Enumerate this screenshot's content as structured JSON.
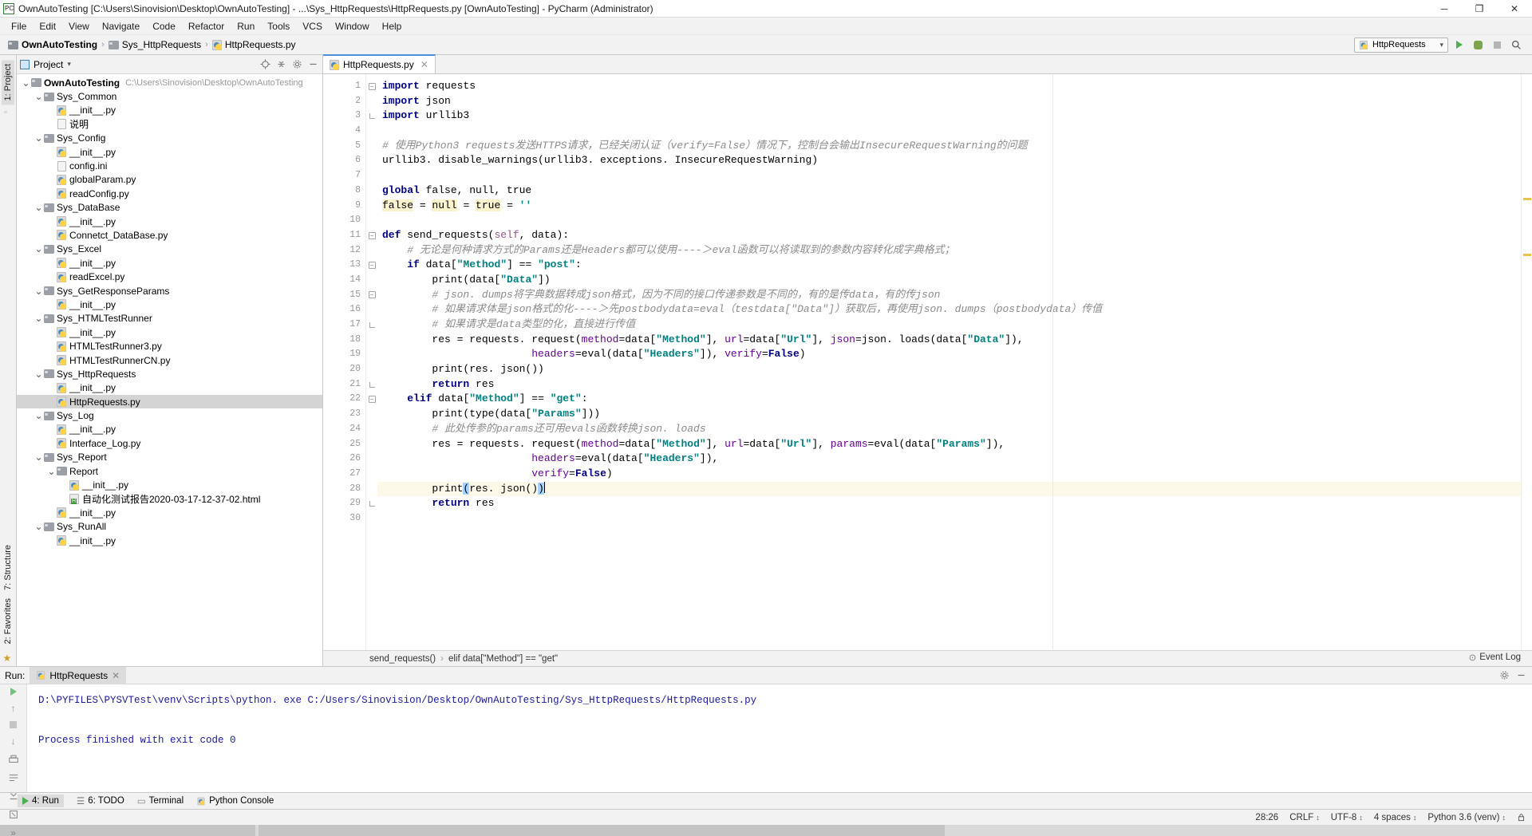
{
  "window": {
    "title": "OwnAutoTesting [C:\\Users\\Sinovision\\Desktop\\OwnAutoTesting] - ...\\Sys_HttpRequests\\HttpRequests.py [OwnAutoTesting] - PyCharm (Administrator)",
    "minimize": "─",
    "maximize": "❐",
    "close": "✕",
    "app_icon": "pycharm-icon"
  },
  "menu": [
    "File",
    "Edit",
    "View",
    "Navigate",
    "Code",
    "Refactor",
    "Run",
    "Tools",
    "VCS",
    "Window",
    "Help"
  ],
  "breadcrumb": {
    "items": [
      "OwnAutoTesting",
      "Sys_HttpRequests",
      "HttpRequests.py"
    ],
    "separator": "›"
  },
  "toolbar": {
    "run_config": "HttpRequests",
    "dropdown_caret": "▾",
    "run_icon": "run-icon",
    "debug_icon": "debug-icon",
    "stop_icon": "stop-icon",
    "search_icon": "search-icon"
  },
  "left_rail": {
    "project_tab": "1: Project",
    "structure_tab": "7: Structure",
    "favorites_tab": "2: Favorites"
  },
  "project_panel": {
    "title": "Project",
    "caret": "▾",
    "locate_icon": "locate-icon",
    "collapse_icon": "collapse-all-icon",
    "settings_icon": "gear-icon",
    "hide_icon": "hide-icon",
    "root": {
      "name": "OwnAutoTesting",
      "path": "C:\\Users\\Sinovision\\Desktop\\OwnAutoTesting"
    },
    "tree": [
      {
        "label": "OwnAutoTesting",
        "path": "C:\\Users\\Sinovision\\Desktop\\OwnAutoTesting",
        "depth": 0,
        "type": "folder",
        "expanded": true,
        "bold": true
      },
      {
        "label": "Sys_Common",
        "depth": 1,
        "type": "folder",
        "expanded": true
      },
      {
        "label": "__init__.py",
        "depth": 2,
        "type": "py"
      },
      {
        "label": "说明",
        "depth": 2,
        "type": "txt"
      },
      {
        "label": "Sys_Config",
        "depth": 1,
        "type": "folder",
        "expanded": true
      },
      {
        "label": "__init__.py",
        "depth": 2,
        "type": "py"
      },
      {
        "label": "config.ini",
        "depth": 2,
        "type": "txt"
      },
      {
        "label": "globalParam.py",
        "depth": 2,
        "type": "py"
      },
      {
        "label": "readConfig.py",
        "depth": 2,
        "type": "py"
      },
      {
        "label": "Sys_DataBase",
        "depth": 1,
        "type": "folder",
        "expanded": true
      },
      {
        "label": "__init__.py",
        "depth": 2,
        "type": "py"
      },
      {
        "label": "Connetct_DataBase.py",
        "depth": 2,
        "type": "py"
      },
      {
        "label": "Sys_Excel",
        "depth": 1,
        "type": "folder",
        "expanded": true
      },
      {
        "label": "__init__.py",
        "depth": 2,
        "type": "py"
      },
      {
        "label": "readExcel.py",
        "depth": 2,
        "type": "py"
      },
      {
        "label": "Sys_GetResponseParams",
        "depth": 1,
        "type": "folder",
        "expanded": true
      },
      {
        "label": "__init__.py",
        "depth": 2,
        "type": "py"
      },
      {
        "label": "Sys_HTMLTestRunner",
        "depth": 1,
        "type": "folder",
        "expanded": true
      },
      {
        "label": "__init__.py",
        "depth": 2,
        "type": "py"
      },
      {
        "label": "HTMLTestRunner3.py",
        "depth": 2,
        "type": "py"
      },
      {
        "label": "HTMLTestRunnerCN.py",
        "depth": 2,
        "type": "py"
      },
      {
        "label": "Sys_HttpRequests",
        "depth": 1,
        "type": "folder",
        "expanded": true
      },
      {
        "label": "__init__.py",
        "depth": 2,
        "type": "py"
      },
      {
        "label": "HttpRequests.py",
        "depth": 2,
        "type": "py",
        "selected": true
      },
      {
        "label": "Sys_Log",
        "depth": 1,
        "type": "folder",
        "expanded": true
      },
      {
        "label": "__init__.py",
        "depth": 2,
        "type": "py"
      },
      {
        "label": "Interface_Log.py",
        "depth": 2,
        "type": "py"
      },
      {
        "label": "Sys_Report",
        "depth": 1,
        "type": "folder",
        "expanded": true
      },
      {
        "label": "Report",
        "depth": 2,
        "type": "folder",
        "expanded": true
      },
      {
        "label": "__init__.py",
        "depth": 3,
        "type": "py"
      },
      {
        "label": "自动化测试报告2020-03-17-12-37-02.html",
        "depth": 3,
        "type": "html"
      },
      {
        "label": "__init__.py",
        "depth": 2,
        "type": "py"
      },
      {
        "label": "Sys_RunAll",
        "depth": 1,
        "type": "folder",
        "expanded": true
      },
      {
        "label": "__init__.py",
        "depth": 2,
        "type": "py"
      }
    ]
  },
  "editor": {
    "tab": {
      "label": "HttpRequests.py",
      "close": "✕",
      "icon": "python-file-icon"
    },
    "first_line": 1,
    "lines": [
      {
        "n": 1,
        "fold": "start",
        "tokens": [
          {
            "t": "import",
            "c": "kw"
          },
          {
            "t": " requests"
          }
        ]
      },
      {
        "n": 2,
        "tokens": [
          {
            "t": "import",
            "c": "kw"
          },
          {
            "t": " json"
          }
        ]
      },
      {
        "n": 3,
        "fold": "end",
        "tokens": [
          {
            "t": "import",
            "c": "kw"
          },
          {
            "t": " urllib3"
          }
        ]
      },
      {
        "n": 4,
        "tokens": []
      },
      {
        "n": 5,
        "tokens": [
          {
            "t": "# 使用Python3 requests发送HTTPS请求，已经关闭认证（verify=False）情况下，控制台会输出InsecureRequestWarning的问题",
            "c": "cmt"
          }
        ]
      },
      {
        "n": 6,
        "tokens": [
          {
            "t": "urllib3. disable_warnings(urllib3. exceptions. InsecureRequestWarning)"
          }
        ]
      },
      {
        "n": 7,
        "tokens": []
      },
      {
        "n": 8,
        "tokens": [
          {
            "t": "global",
            "c": "kw"
          },
          {
            "t": " false, null, true"
          }
        ]
      },
      {
        "n": 9,
        "tokens": [
          {
            "t": "false",
            "c": "hl"
          },
          {
            "t": " = "
          },
          {
            "t": "null",
            "c": "hl"
          },
          {
            "t": " = "
          },
          {
            "t": "true",
            "c": "hl"
          },
          {
            "t": " = "
          },
          {
            "t": "''",
            "c": "str"
          }
        ]
      },
      {
        "n": 10,
        "tokens": []
      },
      {
        "n": 11,
        "fold": "start",
        "tokens": [
          {
            "t": "def",
            "c": "kw"
          },
          {
            "t": " send_requests("
          },
          {
            "t": "self",
            "c": "self"
          },
          {
            "t": ", data):"
          }
        ]
      },
      {
        "n": 12,
        "indent": 1,
        "tokens": [
          {
            "t": "# 无论是何种请求方式的Params还是Headers都可以使用----＞eval函数可以将读取到的参数内容转化成字典格式；",
            "c": "cmt"
          }
        ]
      },
      {
        "n": 13,
        "indent": 1,
        "fold": "start",
        "tokens": [
          {
            "t": "if",
            "c": "kw"
          },
          {
            "t": " data["
          },
          {
            "t": "\"Method\"",
            "c": "str"
          },
          {
            "t": "] == "
          },
          {
            "t": "\"post\"",
            "c": "str"
          },
          {
            "t": ":"
          }
        ]
      },
      {
        "n": 14,
        "indent": 2,
        "tokens": [
          {
            "t": "print(data["
          },
          {
            "t": "\"Data\"",
            "c": "str"
          },
          {
            "t": "])"
          }
        ]
      },
      {
        "n": 15,
        "indent": 2,
        "fold": "start",
        "tokens": [
          {
            "t": "# json. dumps将字典数据转成json格式，因为不同的接口传递参数是不同的，有的是传data，有的传json",
            "c": "cmt"
          }
        ]
      },
      {
        "n": 16,
        "indent": 2,
        "tokens": [
          {
            "t": "# 如果请求体是json格式的化----＞先postbodydata=eval（testdata[\"Data\"]）获取后，再使用json. dumps（postbodydata）传值",
            "c": "cmt"
          }
        ]
      },
      {
        "n": 17,
        "indent": 2,
        "fold": "end",
        "tokens": [
          {
            "t": "# 如果请求是data类型的化，直接进行传值",
            "c": "cmt"
          }
        ]
      },
      {
        "n": 18,
        "indent": 2,
        "tokens": [
          {
            "t": "res = requests. request("
          },
          {
            "t": "method",
            "c": "kwarg"
          },
          {
            "t": "=data["
          },
          {
            "t": "\"Method\"",
            "c": "str"
          },
          {
            "t": "], "
          },
          {
            "t": "url",
            "c": "kwarg"
          },
          {
            "t": "=data["
          },
          {
            "t": "\"Url\"",
            "c": "str"
          },
          {
            "t": "], "
          },
          {
            "t": "json",
            "c": "kwarg"
          },
          {
            "t": "=json. loads(data["
          },
          {
            "t": "\"Data\"",
            "c": "str"
          },
          {
            "t": "]),"
          }
        ]
      },
      {
        "n": 19,
        "indent": 6,
        "tokens": [
          {
            "t": "headers",
            "c": "kwarg"
          },
          {
            "t": "=eval(data["
          },
          {
            "t": "\"Headers\"",
            "c": "str"
          },
          {
            "t": "]), "
          },
          {
            "t": "verify",
            "c": "kwarg"
          },
          {
            "t": "="
          },
          {
            "t": "False",
            "c": "kw"
          },
          {
            "t": ")"
          }
        ]
      },
      {
        "n": 20,
        "indent": 2,
        "tokens": [
          {
            "t": "print(res. json())"
          }
        ]
      },
      {
        "n": 21,
        "indent": 2,
        "fold": "end",
        "tokens": [
          {
            "t": "return",
            "c": "kw"
          },
          {
            "t": " res"
          }
        ]
      },
      {
        "n": 22,
        "indent": 1,
        "fold": "start",
        "tokens": [
          {
            "t": "elif",
            "c": "kw"
          },
          {
            "t": " data["
          },
          {
            "t": "\"Method\"",
            "c": "str"
          },
          {
            "t": "] == "
          },
          {
            "t": "\"get\"",
            "c": "str"
          },
          {
            "t": ":"
          }
        ]
      },
      {
        "n": 23,
        "indent": 2,
        "tokens": [
          {
            "t": "print(type(data["
          },
          {
            "t": "\"Params\"",
            "c": "str"
          },
          {
            "t": "]))"
          }
        ]
      },
      {
        "n": 24,
        "indent": 2,
        "tokens": [
          {
            "t": "# 此处传参的params还可用evals函数转换json. loads",
            "c": "cmt"
          }
        ]
      },
      {
        "n": 25,
        "indent": 2,
        "tokens": [
          {
            "t": "res = requests. request("
          },
          {
            "t": "method",
            "c": "kwarg"
          },
          {
            "t": "=data["
          },
          {
            "t": "\"Method\"",
            "c": "str"
          },
          {
            "t": "], "
          },
          {
            "t": "url",
            "c": "kwarg"
          },
          {
            "t": "=data["
          },
          {
            "t": "\"Url\"",
            "c": "str"
          },
          {
            "t": "], "
          },
          {
            "t": "params",
            "c": "kwarg"
          },
          {
            "t": "=eval(data["
          },
          {
            "t": "\"Params\"",
            "c": "str"
          },
          {
            "t": "]),"
          }
        ]
      },
      {
        "n": 26,
        "indent": 6,
        "tokens": [
          {
            "t": "headers",
            "c": "kwarg"
          },
          {
            "t": "=eval(data["
          },
          {
            "t": "\"Headers\"",
            "c": "str"
          },
          {
            "t": "]),"
          }
        ]
      },
      {
        "n": 27,
        "indent": 6,
        "tokens": [
          {
            "t": "verify",
            "c": "kwarg"
          },
          {
            "t": "="
          },
          {
            "t": "False",
            "c": "kw"
          },
          {
            "t": ")"
          }
        ]
      },
      {
        "n": 28,
        "indent": 2,
        "current": true,
        "tokens": [
          {
            "t": "print"
          },
          {
            "t": "(",
            "c": "sel"
          },
          {
            "t": "res. json()"
          },
          {
            "t": ")",
            "c": "sel"
          }
        ],
        "caret": true
      },
      {
        "n": 29,
        "indent": 2,
        "fold": "end",
        "tokens": [
          {
            "t": "return",
            "c": "kw"
          },
          {
            "t": " res"
          }
        ]
      },
      {
        "n": 30,
        "tokens": []
      }
    ],
    "breadcrumbs": [
      "send_requests()",
      "elif data[\"Method\"] == \"get\""
    ],
    "breadcrumb_sep": "›"
  },
  "run_panel": {
    "label": "Run:",
    "tab": "HttpRequests",
    "tab_close": "✕",
    "settings_icon": "gear-icon",
    "hide_icon": "hide-icon",
    "controls": [
      "rerun-icon",
      "up-icon",
      "stop-icon",
      "down-icon",
      "print-icon",
      "soft-wrap-icon",
      "scroll-icon",
      "clear-icon",
      "more-icon"
    ],
    "output": [
      "D:\\PYFILES\\PYSVTest\\venv\\Scripts\\python. exe C:/Users/Sinovision/Desktop/OwnAutoTesting/Sys_HttpRequests/HttpRequests.py",
      "",
      "Process finished with exit code 0"
    ]
  },
  "bottom_bar": {
    "run": "4: Run",
    "todo": "6: TODO",
    "terminal": "Terminal",
    "python_console": "Python Console"
  },
  "status_bar": {
    "position": "28:26",
    "line_sep": "CRLF",
    "encoding": "UTF-8",
    "indent": "4 spaces",
    "interpreter": "Python 3.6 (venv)",
    "event_log": "Event Log",
    "caret": "↕",
    "lock_icon": "lock-icon"
  },
  "colors": {
    "accent": "#4a90d9",
    "keyword": "#000080",
    "string": "#008080",
    "comment": "#8c8c8c",
    "kwarg": "#660099",
    "highlight": "#fbf3cd",
    "selection": "#a6d2ff",
    "console_text": "#1a1a9c",
    "current_line": "#fcf9e8"
  }
}
